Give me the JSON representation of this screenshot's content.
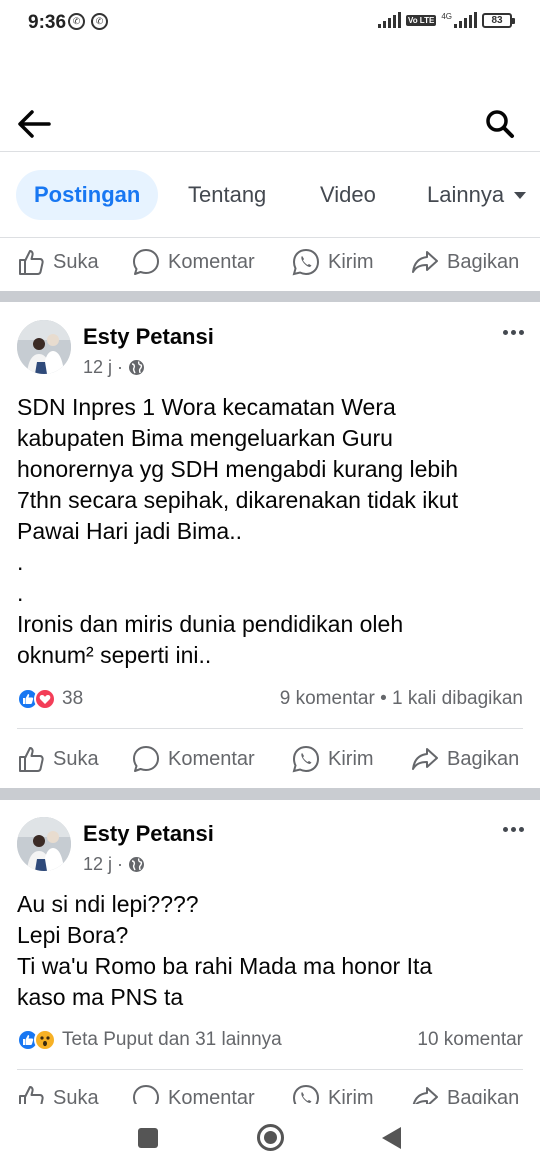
{
  "status_bar": {
    "time": "9:36",
    "network": "4G",
    "volte": "Vo LTE",
    "battery": "83"
  },
  "header": {
    "back_icon": "arrow-left-icon",
    "search_icon": "search-icon"
  },
  "tabs": [
    {
      "label": "Postingan",
      "active": true
    },
    {
      "label": "Tentang",
      "active": false
    },
    {
      "label": "Video",
      "active": false
    },
    {
      "label": "Lainnya",
      "active": false
    }
  ],
  "actions": {
    "like": "Suka",
    "comment": "Komentar",
    "send": "Kirim",
    "share": "Bagikan"
  },
  "posts": [
    {
      "author": "Esty Petansi",
      "time": "12 j",
      "lines": [
        "SDN Inpres 1 Wora kecamatan Wera",
        "kabupaten Bima mengeluarkan Guru",
        "honorernya yg SDH mengabdi kurang lebih",
        "7thn secara sepihak, dikarenakan tidak ikut",
        "Pawai Hari jadi Bima..",
        ".",
        ".",
        "Ironis dan miris dunia pendidikan oleh",
        "oknum² seperti ini.."
      ],
      "reactions": [
        "like",
        "love"
      ],
      "reaction_count": "38",
      "stats_right": "9 komentar • 1 kali dibagikan"
    },
    {
      "author": "Esty Petansi",
      "time": "12 j",
      "lines": [
        "Au si ndi lepi????",
        "Lepi Bora?",
        "Ti wa'u Romo ba rahi Mada ma honor Ita",
        "kaso ma PNS ta"
      ],
      "reactions": [
        "like",
        "wow"
      ],
      "reaction_count": "Teta Puput dan 31 lainnya",
      "stats_right": "10 komentar"
    }
  ],
  "colors": {
    "accent": "#1877f2",
    "tab_active_bg": "#e7f3ff",
    "secondary_text": "#65676b",
    "separator": "#c9ccd1",
    "love": "#f33e58",
    "wow": "#f7b125"
  }
}
